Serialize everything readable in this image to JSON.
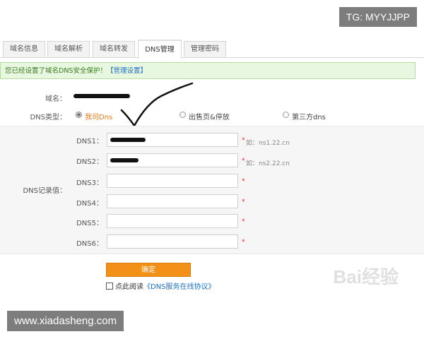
{
  "tabs": [
    {
      "label": "域名信息"
    },
    {
      "label": "域名解析"
    },
    {
      "label": "域名转发"
    },
    {
      "label": "DNS管理"
    },
    {
      "label": "管理密码"
    }
  ],
  "active_tab": "DNS管理",
  "notice": {
    "text": "您已经设置了域名DNS安全保护！",
    "link": "【管理设置】"
  },
  "domain": {
    "label": "域名：",
    "value": ""
  },
  "dns_type": {
    "label": "DNS类型：",
    "options": [
      {
        "label": "我司Dns",
        "selected": true
      },
      {
        "label": "出售页&停放",
        "selected": false
      },
      {
        "label": "第三方dns",
        "selected": false
      }
    ]
  },
  "dns_records": {
    "label": "DNS记录值：",
    "fields": [
      {
        "label": "DNS1：",
        "value": "",
        "hint": "如：ns1.22.cn"
      },
      {
        "label": "DNS2：",
        "value": "",
        "hint": "如：ns2.22.cn"
      },
      {
        "label": "DNS3：",
        "value": "",
        "hint": ""
      },
      {
        "label": "DNS4：",
        "value": "",
        "hint": ""
      },
      {
        "label": "DNS5：",
        "value": "",
        "hint": ""
      },
      {
        "label": "DNS6：",
        "value": "",
        "hint": ""
      }
    ],
    "required_mark": "*"
  },
  "submit_label": "确定",
  "agreement": {
    "prefix": "点此阅读",
    "link": "《DNS服务在线协议》",
    "checked": true
  },
  "watermarks": {
    "top_right": "TG: MYYJJPP",
    "bottom_left": "www.xiadasheng.com",
    "baidu": "Bai经验"
  },
  "colors": {
    "accent": "#f29017",
    "notice_bg": "#e8f7e0",
    "selected_option": "#e57a1c",
    "link": "#1f6fbf"
  }
}
